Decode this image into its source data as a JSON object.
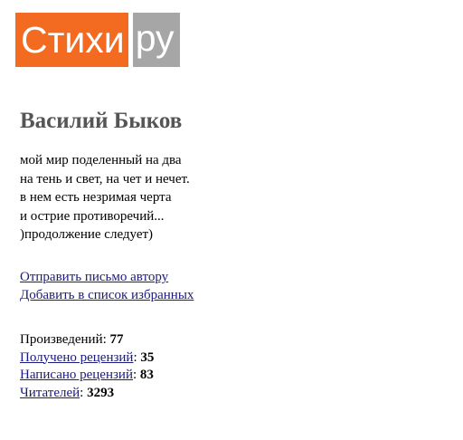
{
  "logo": {
    "main": "Стихи",
    "tld": "ру"
  },
  "author": {
    "name": "Василий Быков"
  },
  "bio": [
    "мой мир поделенный на два",
    "на тень и свет, на чет и нечет.",
    "в нем есть незримая черта",
    "и острие противоречий...",
    ")продолжение следует)"
  ],
  "links": {
    "send_letter": "Отправить письмо автору",
    "add_favorites": "Добавить в список избранных"
  },
  "stats": {
    "works_label": "Произведений",
    "works_count": "77",
    "received_label": "Получено рецензий",
    "received_count": "35",
    "written_label": "Написано рецензий",
    "written_count": "83",
    "readers_label": "Читателей",
    "readers_count": "3293"
  },
  "colors": {
    "logo_orange": "#f26b21",
    "logo_gray": "#a6a6a6",
    "name_gray": "#555555",
    "link": "#1a1a80"
  }
}
